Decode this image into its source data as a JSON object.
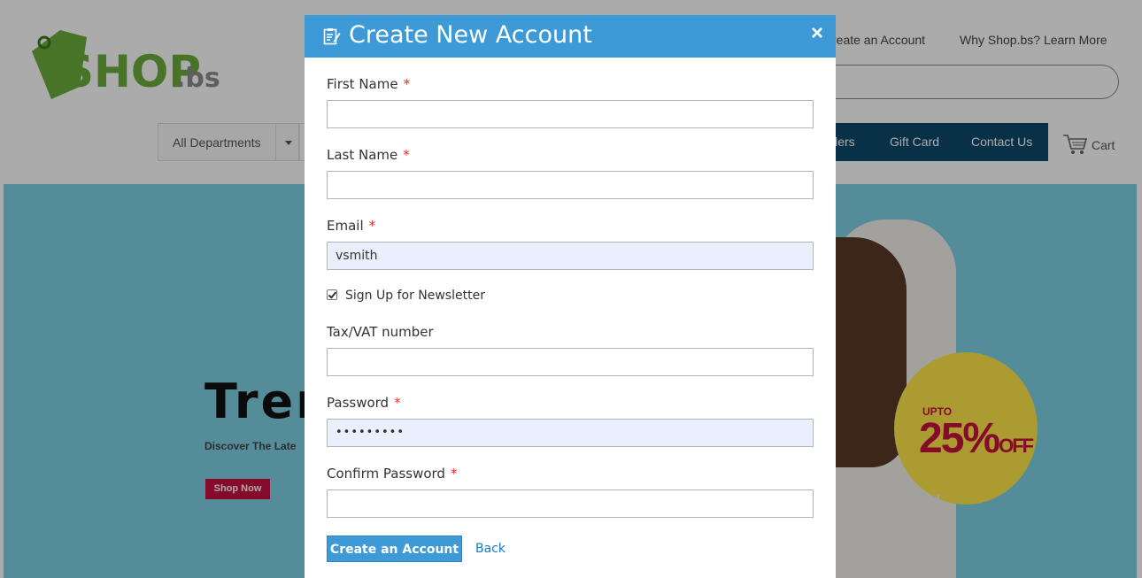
{
  "background": {
    "logo_text": "SHOP.bs",
    "top_links": [
      "reate an Account",
      "Why Shop.bs? Learn More"
    ],
    "departments_label": "All Departments",
    "nav_items": [
      "llers",
      "Gift Card",
      "Contact Us"
    ],
    "cart_label": "Cart",
    "hero": {
      "title": "Tren",
      "subtitle": "Discover The Late",
      "cta_label": "Shop Now",
      "badge_upto": "UPTO",
      "badge_percent": "25%",
      "badge_off": "OFF"
    }
  },
  "modal": {
    "title": "Create New Account",
    "close_label": "×",
    "fields": {
      "first_name": {
        "label": "First Name",
        "required_mark": "*",
        "value": ""
      },
      "last_name": {
        "label": "Last Name",
        "required_mark": "*",
        "value": ""
      },
      "email": {
        "label": "Email",
        "required_mark": "*",
        "value": "vsmith"
      },
      "tax_vat": {
        "label": "Tax/VAT number",
        "value": ""
      },
      "password": {
        "label": "Password",
        "required_mark": "*",
        "value": "•••••••••"
      },
      "confirm_password": {
        "label": "Confirm Password",
        "required_mark": "*",
        "value": ""
      }
    },
    "newsletter": {
      "label": "Sign Up for Newsletter",
      "checked": true
    },
    "submit_label": "Create an Account",
    "back_label": "Back"
  },
  "colors": {
    "header_blue": "#3d9ad6",
    "nav_dark": "#0d4a6b",
    "required_red": "#e02b27",
    "link_blue": "#1979c3",
    "hero_bg": "#7ed1e5"
  },
  "icons": [
    "edit-note-icon",
    "close-icon",
    "cart-icon",
    "chevron-down-icon"
  ]
}
